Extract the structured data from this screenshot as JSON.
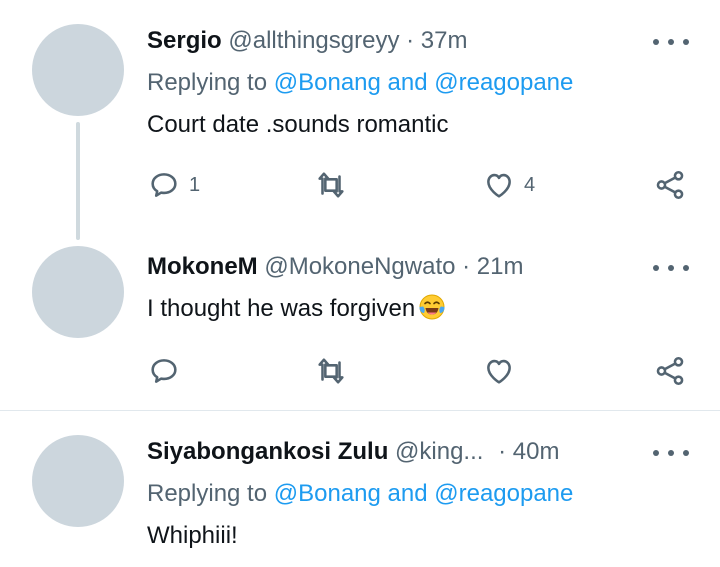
{
  "tweets": [
    {
      "name": "Sergio",
      "handle": "@allthingsgreyy",
      "time": "· 37m",
      "replying_prefix": "Replying to",
      "replying_to": "@Bonang and @reagopane",
      "text": "Court date .sounds romantic",
      "reply_count": "1",
      "retweet_count": "",
      "like_count": "4"
    },
    {
      "name": "MokoneM",
      "handle": "@MokoneNgwato",
      "time": "· 21m",
      "text": "I thought he was forgiven",
      "text_emoji": "face-with-tears-of-joy",
      "reply_count": "",
      "retweet_count": "",
      "like_count": ""
    },
    {
      "name": "Siyabongankosi Zulu",
      "handle": "@king...",
      "time": "· 40m",
      "replying_prefix": "Replying to",
      "replying_to": "@Bonang and @reagopane",
      "text": "Whiphiii!"
    }
  ],
  "icons": {
    "reply": "reply-icon",
    "retweet": "retweet-icon",
    "like": "heart-icon",
    "share": "share-icon",
    "more": "more-options-icon"
  },
  "colors": {
    "link": "#1d9bf0",
    "muted": "#536471",
    "avatar": "#ccd6dd"
  }
}
